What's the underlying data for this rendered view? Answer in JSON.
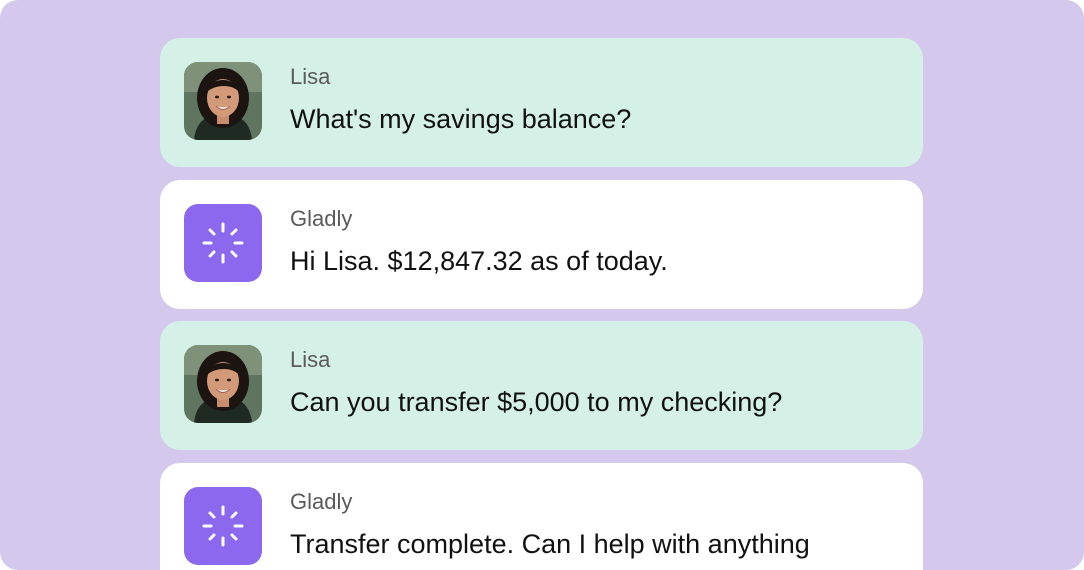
{
  "colors": {
    "background": "#d4c9ec",
    "customer_bubble": "#d5f0e6",
    "agent_bubble": "#ffffff",
    "agent_avatar": "#8b68ee"
  },
  "conversation": {
    "messages": [
      {
        "sender": "Lisa",
        "role": "customer",
        "avatar_icon": "customer-photo",
        "text": "What's my savings balance?"
      },
      {
        "sender": "Gladly",
        "role": "agent",
        "avatar_icon": "sparkle-icon",
        "text": "Hi Lisa. $12,847.32 as of today."
      },
      {
        "sender": "Lisa",
        "role": "customer",
        "avatar_icon": "customer-photo",
        "text": "Can you transfer $5,000 to my checking?"
      },
      {
        "sender": "Gladly",
        "role": "agent",
        "avatar_icon": "sparkle-icon",
        "text": "Transfer complete. Can I help with anything"
      }
    ]
  }
}
